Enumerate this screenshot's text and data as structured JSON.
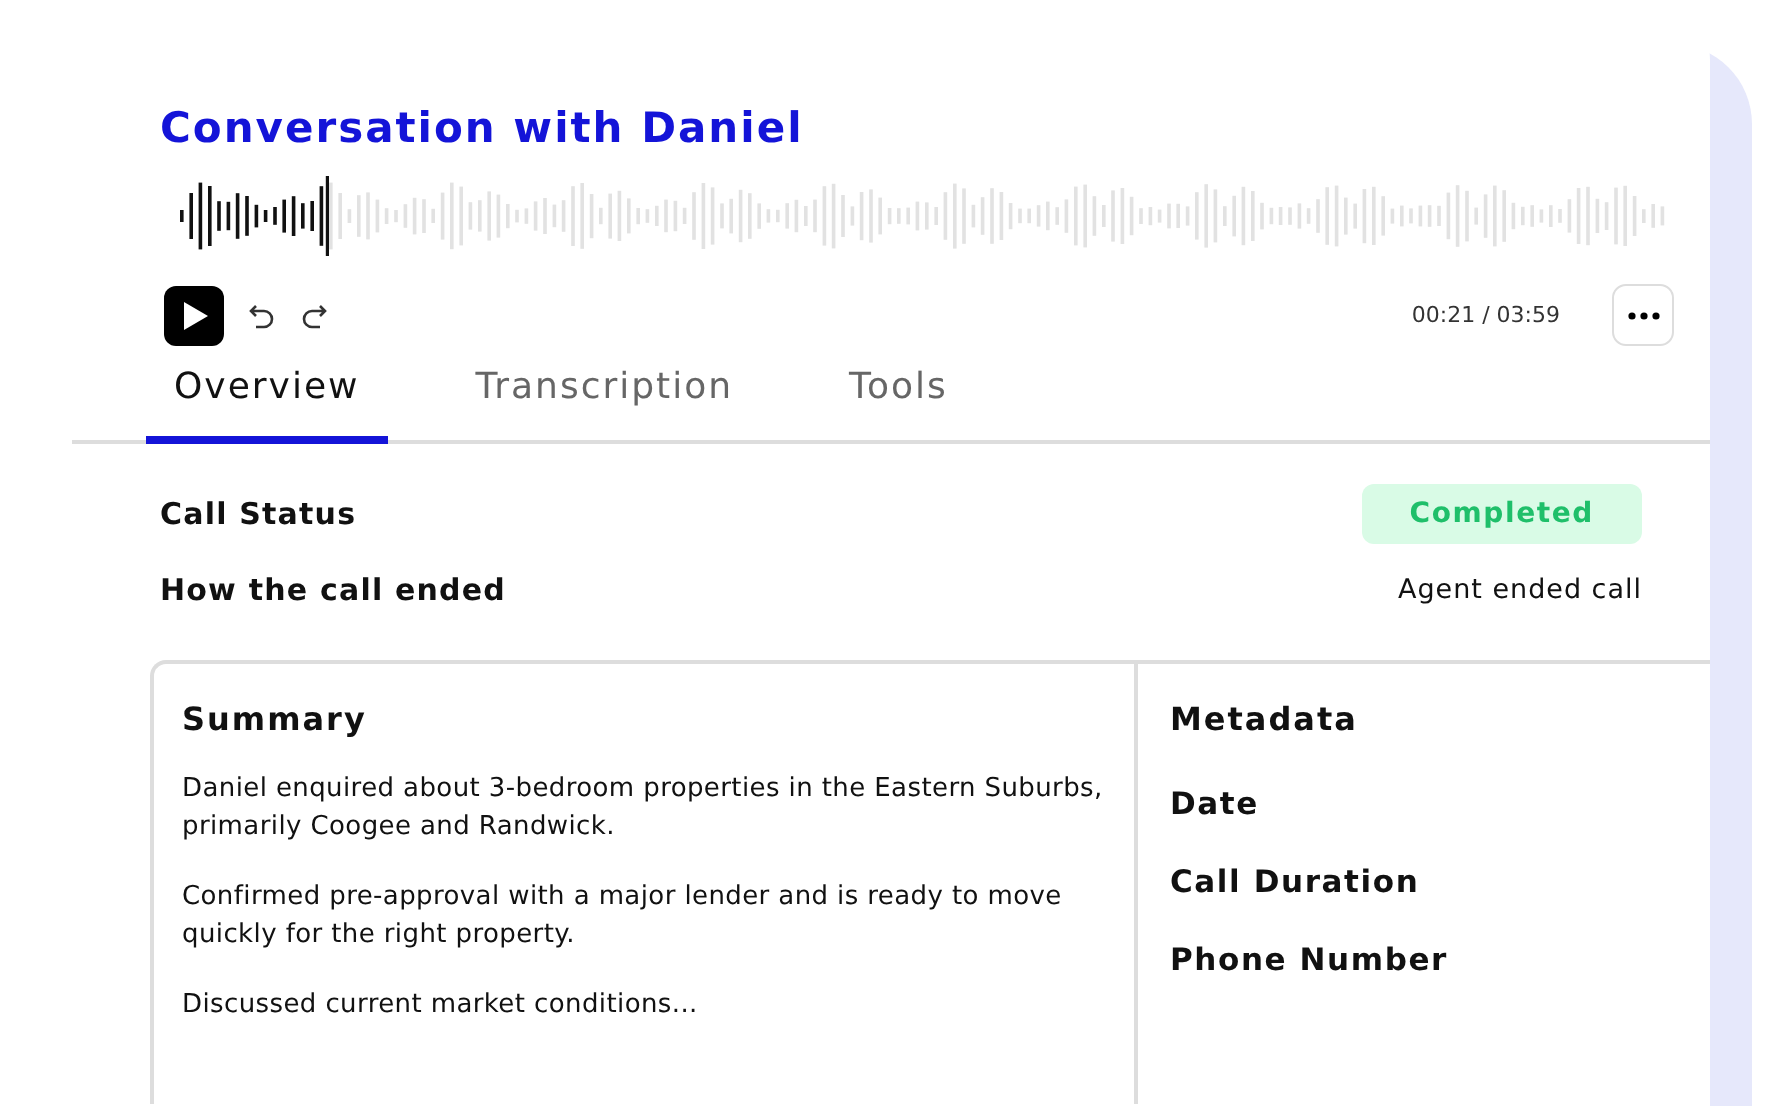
{
  "title": "Conversation with Daniel",
  "player": {
    "level": 0.1,
    "time": "00:21 / 03:59"
  },
  "tabs": [
    {
      "label": "Overview",
      "selected": true
    },
    {
      "label": "Transcription",
      "selected": false
    },
    {
      "label": "Tools",
      "selected": false
    }
  ],
  "fields": [
    {
      "label": "Call Status",
      "value": "Completed",
      "kind": "badge"
    },
    {
      "label": "How the call ended",
      "value": "Agent ended call",
      "kind": "text"
    }
  ],
  "summary": {
    "heading": "Summary",
    "paragraphs": [
      "Daniel enquired about 3-bedroom properties in the Eastern Suburbs, primarily Coogee and Randwick.",
      "Confirmed pre-approval with a major lender and is ready to move quickly for the right property.",
      "Discussed current market conditions..."
    ]
  },
  "metadata": {
    "heading": "Metadata",
    "items": [
      "Date",
      "Call Duration",
      "Phone Number"
    ]
  }
}
